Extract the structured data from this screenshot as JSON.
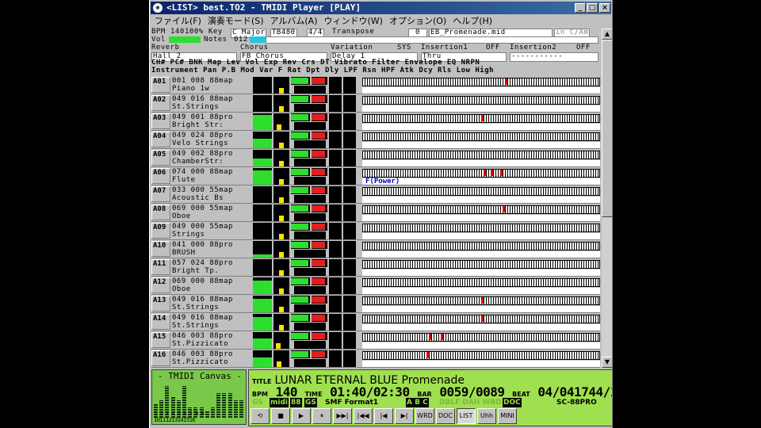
{
  "window": {
    "title": "<LIST> best.TO2 - TMIDI Player [PLAY]",
    "app_icon": "tmidi-icon",
    "buttons": [
      "_",
      "□",
      "×"
    ]
  },
  "menu": [
    "ファイル(F)",
    "演奏モード(S)",
    "アルバム(A)",
    "ウィンドウ(W)",
    "オプション(O)",
    "ヘルプ(H)"
  ],
  "info": {
    "bpm_label": "BPM",
    "bpm": "140",
    "percent": "100%",
    "key_label": "Key",
    "key": "C Major",
    "tb": "TB480",
    "time_sig": "4/4",
    "transpose_label": "Transpose",
    "transpose": "0",
    "file": "EB_Promenade.mid",
    "instrument_mode": "in C/Am",
    "vol_label": "Vol",
    "notes_label": "Notes",
    "notes": "012",
    "reverb_label": "Reverb",
    "reverb": "Hall 2",
    "chorus_label": "Chorus",
    "chorus": "FB Chorus",
    "variation_label": "Variation",
    "variation_mode": "SYS",
    "variation": "Delay 1",
    "ins1_label": "Insertion1",
    "ins1": "OFF",
    "ins1_val": "Thru",
    "ins2_label": "Insertion2",
    "ins2": "OFF",
    "ins2_val": "-----------"
  },
  "header": {
    "line1": "CH# PC# BNK Map     Lev Vol Exp Rev Crs DT  Vibrato   Filter  Envelope EQ   NRPN",
    "line2": "    Instrument           Pan P.B Mod Var F  Rat Dpt Dly LPF Rsn HPF Atk Dcy Rls Low  High"
  },
  "channels": [
    {
      "ch": "A01",
      "pc": "001 008 88map",
      "inst": "Piano 1w",
      "lev": 0,
      "pan": 0.5,
      "vol": 0.9,
      "exp": 0.85,
      "notes": [
        0.6
      ]
    },
    {
      "ch": "A02",
      "pc": "049 016 88map",
      "inst": "St.Strings",
      "lev": 0,
      "pan": 0.5,
      "vol": 0.9,
      "exp": 0.85,
      "notes": []
    },
    {
      "ch": "A03",
      "pc": "049 001 88pro",
      "inst": "Bright Str:",
      "lev": 0.9,
      "pan": 0.3,
      "vol": 0.9,
      "exp": 0.85,
      "notes": [
        0.5
      ]
    },
    {
      "ch": "A04",
      "pc": "049 024 88pro",
      "inst": "Velo Strings",
      "lev": 0.55,
      "pan": 0.5,
      "vol": 0.9,
      "exp": 0.85,
      "notes": []
    },
    {
      "ch": "A05",
      "pc": "049 002 88pro",
      "inst": "ChamberStr:",
      "lev": 0.5,
      "pan": 0.5,
      "vol": 0.9,
      "exp": 0.85,
      "notes": []
    },
    {
      "ch": "A06",
      "pc": "074 000 88map",
      "inst": "Flute",
      "lev": 0.85,
      "pan": 0.5,
      "vol": 0.9,
      "exp": 0.85,
      "notes": [
        0.51,
        0.54,
        0.58
      ],
      "bend": "F(Power)"
    },
    {
      "ch": "A07",
      "pc": "033 000 55map",
      "inst": "Acoustic Bs",
      "lev": 0,
      "pan": 0.5,
      "vol": 0.9,
      "exp": 0.85,
      "notes": []
    },
    {
      "ch": "A08",
      "pc": "069 000 55map",
      "inst": "Oboe",
      "lev": 0,
      "pan": 0.5,
      "vol": 0.9,
      "exp": 0.85,
      "notes": [
        0.59
      ]
    },
    {
      "ch": "A09",
      "pc": "049 000 55map",
      "inst": "Strings",
      "lev": 0,
      "pan": 0.5,
      "vol": 0.9,
      "exp": 0.85,
      "notes": []
    },
    {
      "ch": "A10",
      "pc": "041 000 88pro",
      "inst": "BRUSH",
      "lev": 0.2,
      "pan": 0.5,
      "vol": 0.9,
      "exp": 0.85,
      "notes": []
    },
    {
      "ch": "A11",
      "pc": "057 024 88pro",
      "inst": "Bright Tp.",
      "lev": 0,
      "pan": 0.5,
      "vol": 0.9,
      "exp": 0.85,
      "notes": []
    },
    {
      "ch": "A12",
      "pc": "069 000 88map",
      "inst": "Oboe",
      "lev": 0.8,
      "pan": 0.5,
      "vol": 0.9,
      "exp": 0.85,
      "notes": []
    },
    {
      "ch": "A13",
      "pc": "049 016 88map",
      "inst": "St.Strings",
      "lev": 0.8,
      "pan": 0.5,
      "vol": 0.9,
      "exp": 0.85,
      "notes": [
        0.5
      ]
    },
    {
      "ch": "A14",
      "pc": "049 016 88map",
      "inst": "St.Strings",
      "lev": 0.8,
      "pan": 0.5,
      "vol": 0.9,
      "exp": 0.85,
      "notes": [
        0.5
      ]
    },
    {
      "ch": "A15",
      "pc": "046 003 88pro",
      "inst": "St.Pizzicato",
      "lev": 0.6,
      "pan": 0.2,
      "vol": 0.9,
      "exp": 0.85,
      "notes": [
        0.28,
        0.33
      ]
    },
    {
      "ch": "A16",
      "pc": "046 003 88pro",
      "inst": "St.Pizzicato",
      "lev": 0.55,
      "pan": 0.3,
      "vol": 0.9,
      "exp": 0.85,
      "notes": [
        0.27
      ]
    }
  ],
  "canvas": {
    "title": "- TMIDI Canvas -",
    "numbers": "1 2 3 4 5 6 7 8 9 10111213141516",
    "levels": [
      0.4,
      0.5,
      0.9,
      0.6,
      0.5,
      0.9,
      0.3,
      0.3,
      0.3,
      0.2,
      0.3,
      0.7,
      0.7,
      0.7,
      0.5,
      0.5
    ]
  },
  "panel": {
    "title_label": "TITLE",
    "title": "LUNAR ETERNAL BLUE Promenade",
    "bpm_label": "BPM",
    "bpm": "140",
    "time_label": "TIME",
    "time": "01:40/02:30",
    "bar_label": "BAR",
    "bar": "0059/0089",
    "beat_label": "BEAT",
    "beat": "04/041744/1920",
    "format": "SMF Format1",
    "module": "SC-88PRO",
    "abc": "A B C"
  },
  "controls": [
    "⟲",
    "■",
    "▶",
    "⏸",
    "▶▶|",
    "|◀◀",
    "|◀",
    "▶|",
    "WRD",
    "DOC",
    "LIST",
    "Uhh",
    "MINI"
  ]
}
